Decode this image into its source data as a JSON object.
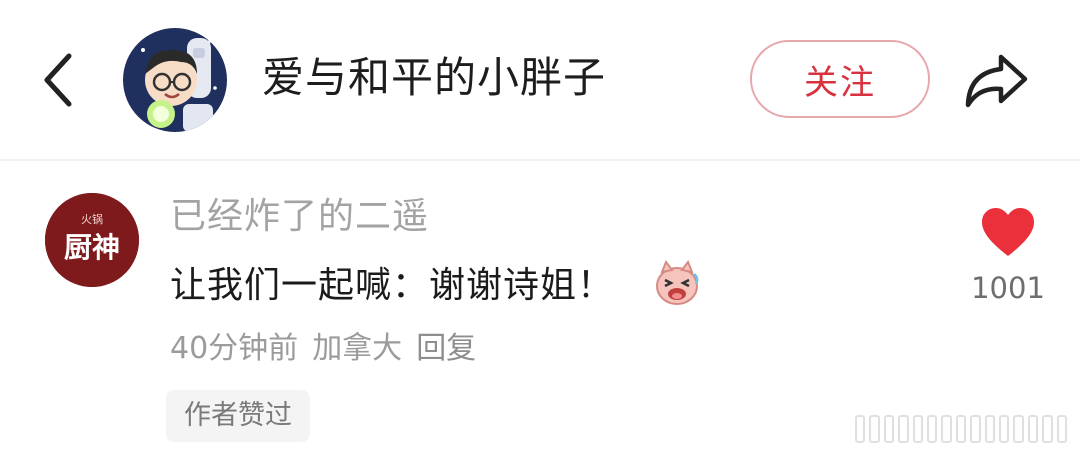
{
  "header": {
    "username": "爱与和平的小胖子",
    "follow_label": "关注",
    "back_icon": "chevron-left-icon",
    "share_icon": "share-arrow-icon"
  },
  "comment": {
    "author": "已经炸了的二遥",
    "avatar_badge": "厨神",
    "avatar_badge_small": "火锅",
    "text": "让我们一起喊：谢谢诗姐！",
    "emoji": "laughing-pig-emoji",
    "time": "40分钟前",
    "location": "加拿大",
    "reply_label": "回复",
    "like_count": "1001",
    "like_icon": "heart-icon",
    "author_liked_badge": "作者赞过"
  },
  "colors": {
    "accent_red": "#d8323f",
    "heart_red": "#e9303b",
    "avatar_bg": "#7e1a1c"
  }
}
